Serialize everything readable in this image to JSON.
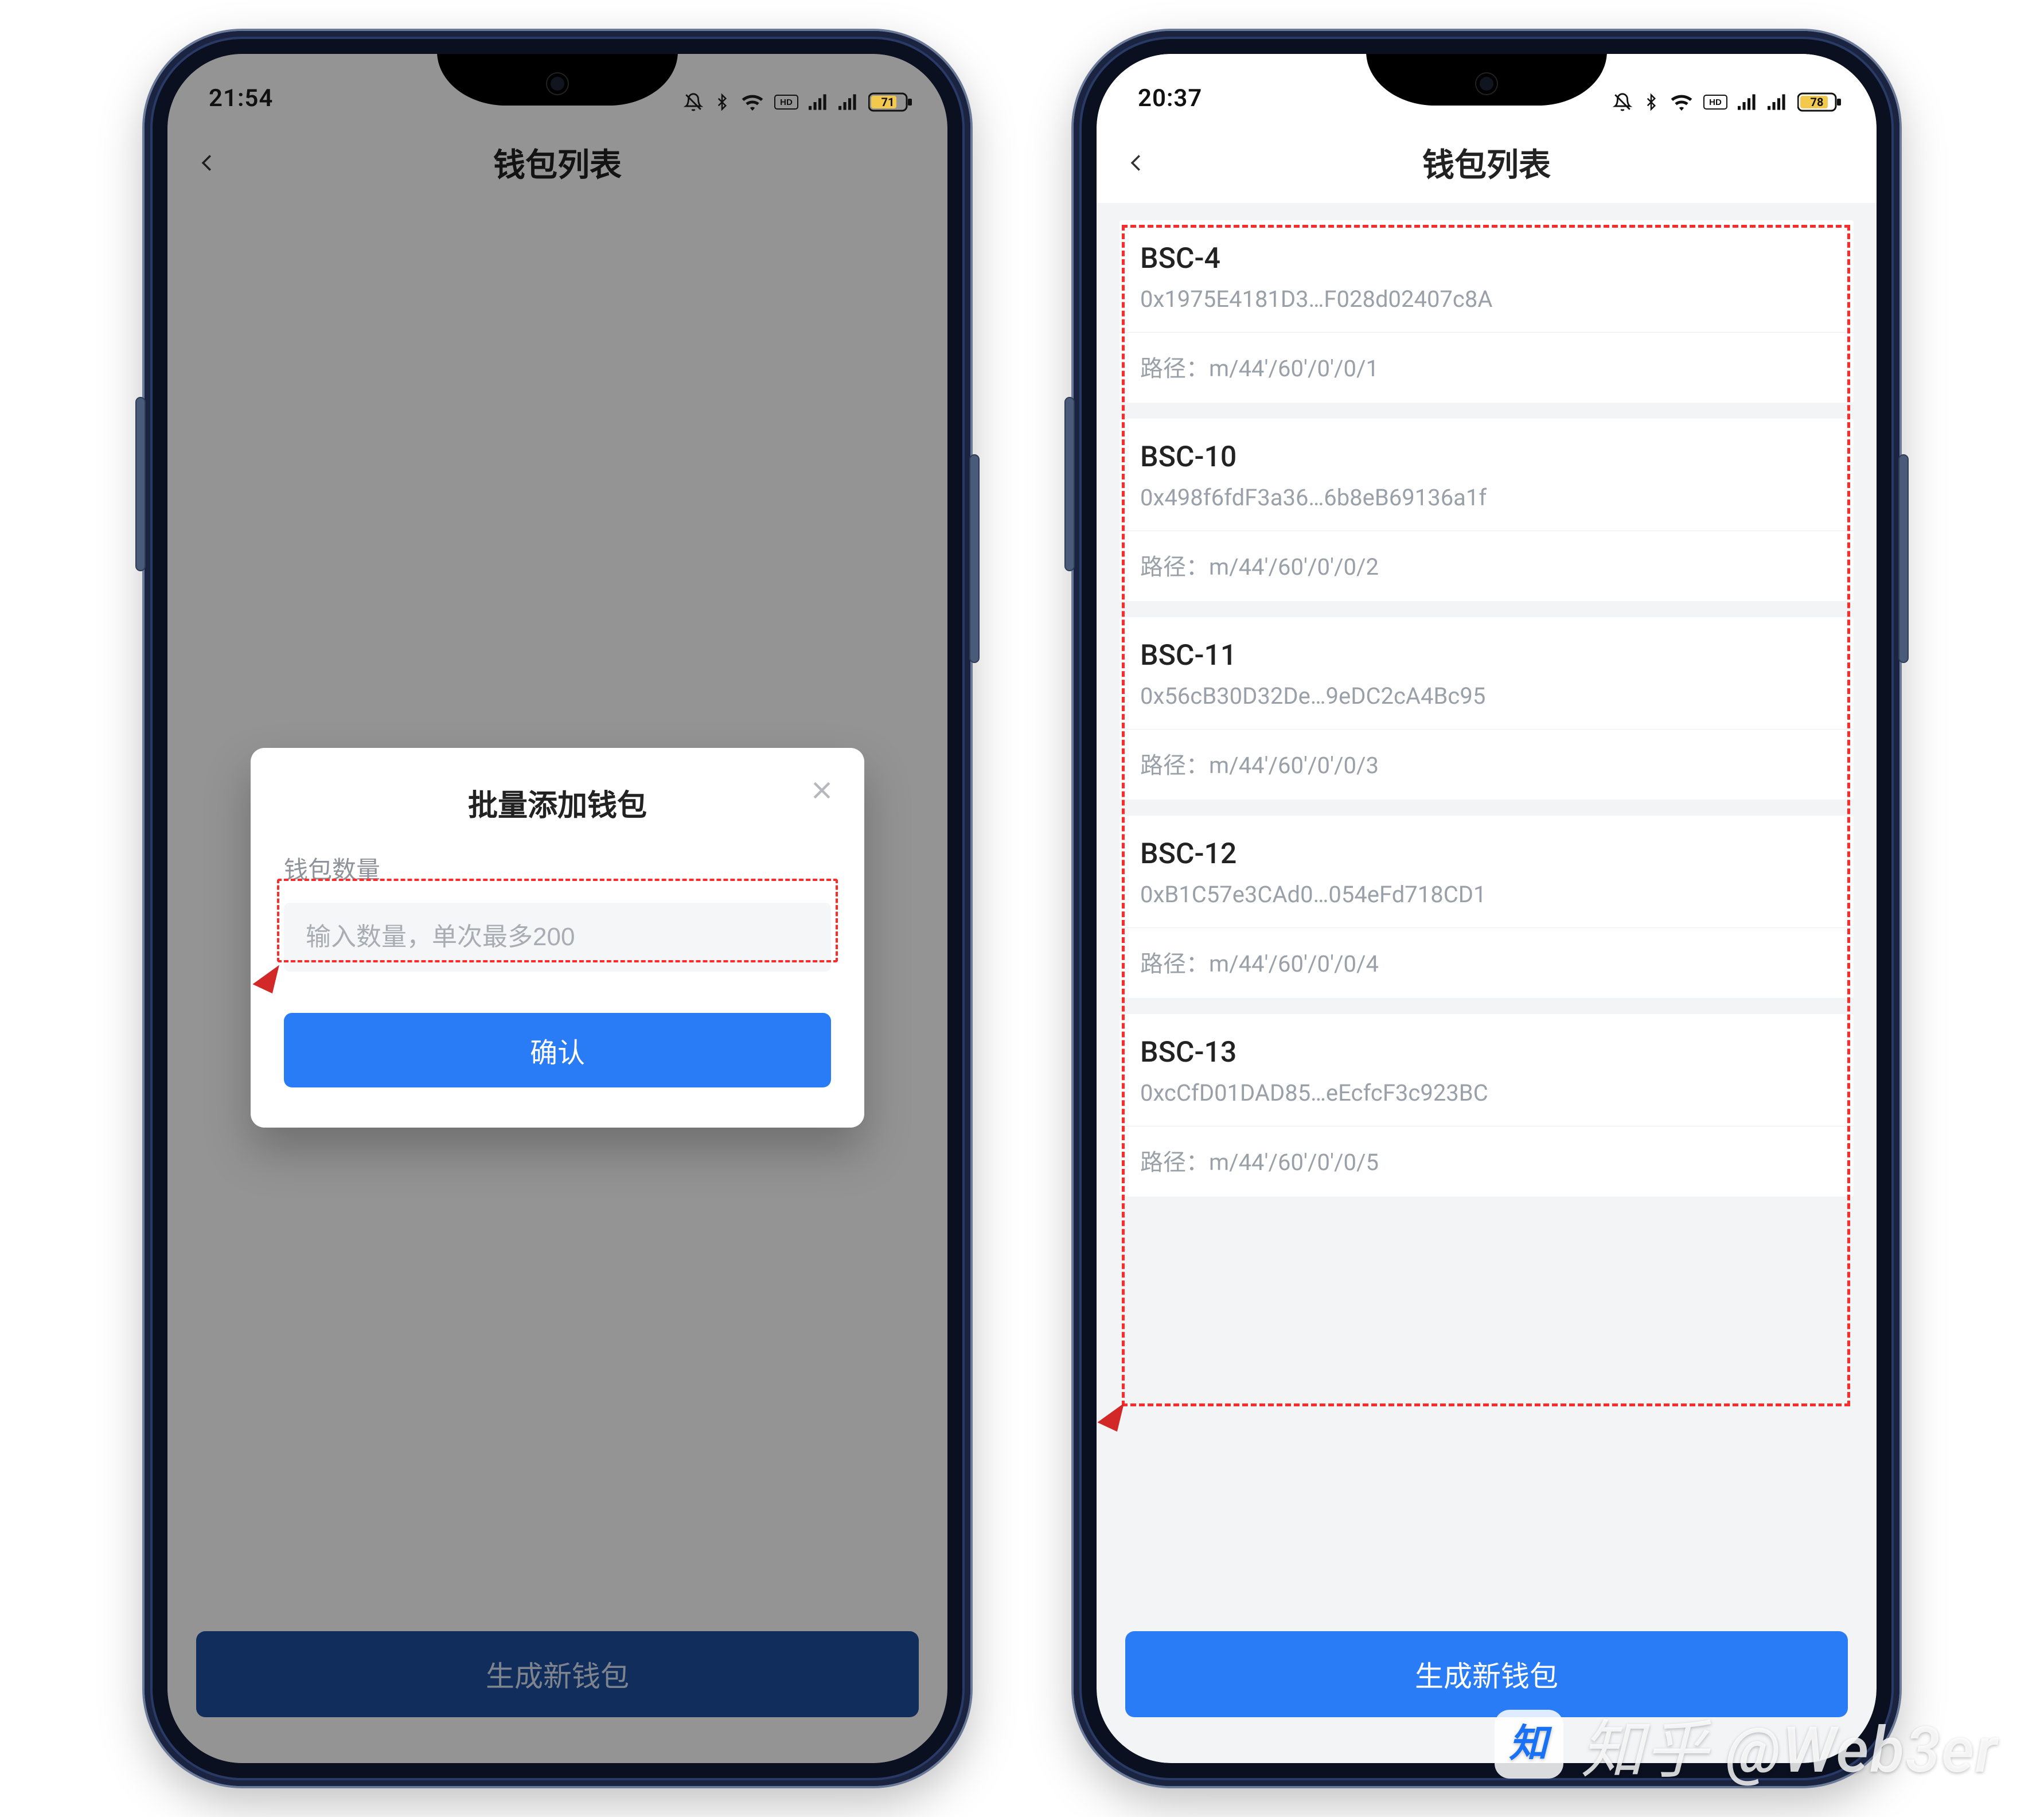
{
  "colors": {
    "primary": "#2a7bf6",
    "primaryDim": "#1e4e9e",
    "annotation": "#ff2a2a"
  },
  "phoneA": {
    "statusbar": {
      "time": "21:54",
      "battery": "71"
    },
    "header": {
      "title": "钱包列表"
    },
    "dialog": {
      "title": "批量添加钱包",
      "label": "钱包数量",
      "placeholder": "输入数量，单次最多200",
      "confirm": "确认"
    },
    "primaryButton": "生成新钱包"
  },
  "phoneB": {
    "statusbar": {
      "time": "20:37",
      "battery": "78"
    },
    "header": {
      "title": "钱包列表"
    },
    "pathPrefix": "路径：",
    "wallets": [
      {
        "name": "BSC-4",
        "addr": "0x1975E4181D3…F028d02407c8A",
        "path": "m/44'/60'/0'/0/1"
      },
      {
        "name": "BSC-10",
        "addr": "0x498f6fdF3a36…6b8eB69136a1f",
        "path": "m/44'/60'/0'/0/2"
      },
      {
        "name": "BSC-11",
        "addr": "0x56cB30D32De…9eDC2cA4Bc95",
        "path": "m/44'/60'/0'/0/3"
      },
      {
        "name": "BSC-12",
        "addr": "0xB1C57e3CAd0…054eFd718CD1",
        "path": "m/44'/60'/0'/0/4"
      },
      {
        "name": "BSC-13",
        "addr": "0xcCfD01DAD85…eEcfcF3c923BC",
        "path": "m/44'/60'/0'/0/5"
      }
    ],
    "primaryButton": "生成新钱包"
  },
  "watermark": "知乎 @Web3er"
}
